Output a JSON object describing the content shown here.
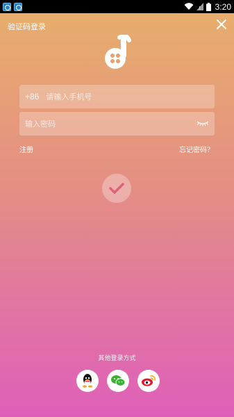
{
  "status_bar": {
    "time": "3:20"
  },
  "header": {
    "title": "验证码登录"
  },
  "form": {
    "phone_prefix": "+86",
    "phone_placeholder": "请输入手机号",
    "password_placeholder": "输入密码"
  },
  "links": {
    "register": "注册",
    "forgot": "忘记密码？"
  },
  "footer": {
    "other_label": "其他登录方式",
    "socials": [
      {
        "icon": "qq-icon"
      },
      {
        "icon": "wechat-icon"
      },
      {
        "icon": "weibo-icon"
      }
    ]
  },
  "colors": {
    "gradient_top": "#e8b06a",
    "gradient_bottom": "#df5fb8",
    "wechat": "#3cb034",
    "weibo": "#e6162d",
    "check": "#e0607a"
  }
}
